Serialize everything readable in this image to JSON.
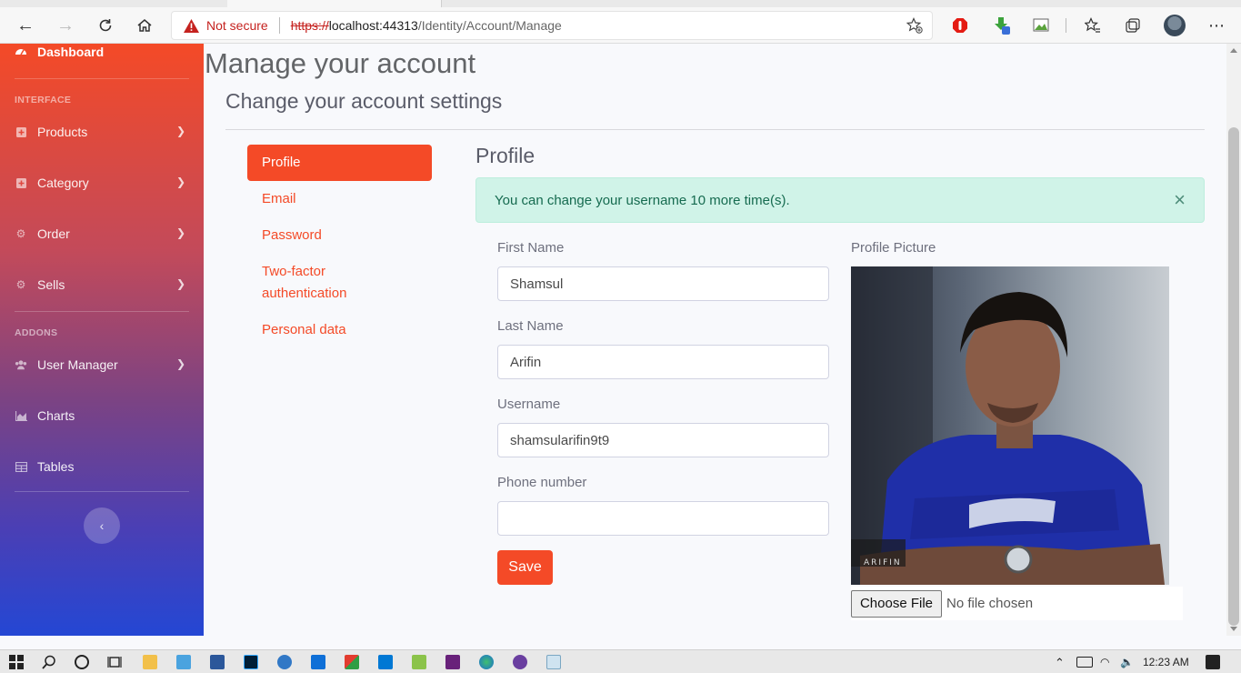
{
  "browser": {
    "security_label": "Not secure",
    "url_scheme": "https://",
    "url_host": "localhost:44313",
    "url_path": "/Identity/Account/Manage"
  },
  "sidebar": {
    "dashboard_label": "Dashboard",
    "heading_interface": "INTERFACE",
    "heading_addons": "ADDONS",
    "items": [
      {
        "label": "Products",
        "icon": "plus-square-icon"
      },
      {
        "label": "Category",
        "icon": "plus-square-icon"
      },
      {
        "label": "Order",
        "icon": "gear-icon"
      },
      {
        "label": "Sells",
        "icon": "gear-icon"
      },
      {
        "label": "User Manager",
        "icon": "users-icon"
      },
      {
        "label": "Charts",
        "icon": "chart-area-icon"
      },
      {
        "label": "Tables",
        "icon": "table-icon"
      }
    ],
    "toggle_glyph": "‹"
  },
  "page": {
    "title": "Manage your account",
    "subtitle": "Change your account settings"
  },
  "nav": {
    "items": [
      "Profile",
      "Email",
      "Password",
      "Two-factor authentication",
      "Personal data"
    ],
    "two_factor_line1": "Two-factor",
    "two_factor_line2": "authentication"
  },
  "profile": {
    "heading": "Profile",
    "alert_text": "You can change your username 10 more time(s).",
    "alert_close": "×",
    "first_name_label": "First Name",
    "first_name_value": "Shamsul",
    "last_name_label": "Last Name",
    "last_name_value": "Arifin",
    "username_label": "Username",
    "username_value": "shamsularifin9t9",
    "phone_label": "Phone number",
    "phone_value": "",
    "save_label": "Save",
    "picture_label": "Profile Picture",
    "photo_watermark": "ARIFIN",
    "choose_file_label": "Choose File",
    "no_file_label": "No file chosen"
  },
  "taskbar": {
    "time": "12:23 AM"
  },
  "colors": {
    "accent": "#f44a27",
    "alert_bg": "#d0f3e8",
    "alert_text": "#166b50"
  }
}
